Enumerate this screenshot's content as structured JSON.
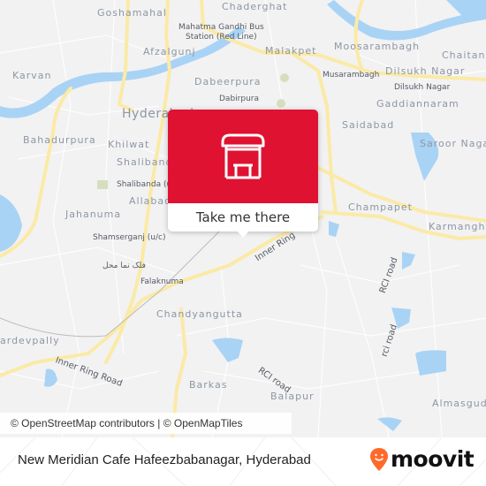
{
  "map": {
    "area_labels": [
      {
        "id": "goshamahal",
        "text": "Goshamahal"
      },
      {
        "id": "chaderghat",
        "text": "Chaderghat"
      },
      {
        "id": "karvan",
        "text": "Karvan"
      },
      {
        "id": "afzalgunj",
        "text": "Afzalgunj"
      },
      {
        "id": "malakpet",
        "text": "Malakpet"
      },
      {
        "id": "moosarambagh",
        "text": "Moosarambagh"
      },
      {
        "id": "chaitanya",
        "text": "Chaitanya"
      },
      {
        "id": "dilsukh-nagar-area",
        "text": "Dilsukh Nagar"
      },
      {
        "id": "dabeerpura",
        "text": "Dabeerpura"
      },
      {
        "id": "hyderabad",
        "text": "Hyderabad"
      },
      {
        "id": "gaddiannaram",
        "text": "Gaddiannaram"
      },
      {
        "id": "bahadurpura",
        "text": "Bahadurpura"
      },
      {
        "id": "khilwat",
        "text": "Khilwat"
      },
      {
        "id": "saidabad",
        "text": "Saidabad"
      },
      {
        "id": "saroor-nagar",
        "text": "Saroor Nagar"
      },
      {
        "id": "shalibanda",
        "text": "Shalibanda"
      },
      {
        "id": "allabad",
        "text": "Allabad"
      },
      {
        "id": "jahanuma",
        "text": "Jahanuma"
      },
      {
        "id": "champapet",
        "text": "Champapet"
      },
      {
        "id": "karmanghat",
        "text": "Karmanghat"
      },
      {
        "id": "chandyangutta",
        "text": "Chandyangutta"
      },
      {
        "id": "kishan-bagh-dev-pally",
        "text": "ardevpally"
      },
      {
        "id": "barkas",
        "text": "Barkas"
      },
      {
        "id": "balapur",
        "text": "Balapur"
      },
      {
        "id": "almasguda",
        "text": "Almasguda"
      }
    ],
    "poi_labels": [
      {
        "id": "mgbs",
        "text": "Mahatma Gandhi Bus"
      },
      {
        "id": "mgbs2",
        "text": "Station (Red Line)"
      },
      {
        "id": "musarambagh",
        "text": "Musarambagh"
      },
      {
        "id": "dilsukh-nagar-station",
        "text": "Dilsukh Nagar"
      },
      {
        "id": "dabirpura",
        "text": "Dabirpura"
      },
      {
        "id": "shalibanda-uc",
        "text": "Shalibanda (u/c)"
      },
      {
        "id": "shamserganj",
        "text": "Shamserganj (u/c)"
      },
      {
        "id": "falaknuma-urdu",
        "text": "فلک نما محل"
      },
      {
        "id": "falaknuma",
        "text": "Falaknuma"
      }
    ],
    "road_labels": [
      {
        "id": "inner-ring-1",
        "text": "Inner Ring"
      },
      {
        "id": "inner-ring-road",
        "text": "Inner Ring Road"
      },
      {
        "id": "rci-road-1",
        "text": "RCI road"
      },
      {
        "id": "rci-road-2",
        "text": "rci road"
      },
      {
        "id": "rci-road-3",
        "text": "RCI road"
      }
    ],
    "popup": {
      "icon": "bus-stop-shelter-icon",
      "cta_label": "Take me there",
      "accent": "#e01232"
    },
    "attribution": "© OpenStreetMap contributors | © OpenMapTiles",
    "colors": {
      "land": "#f2f2f3",
      "water": "#a9d3f5",
      "major_road": "#fbeaa6",
      "park": "#d5dfbd"
    }
  },
  "footer": {
    "title": "New Meridian Cafe Hafeezbabanagar, Hyderabad",
    "brand": "moovit",
    "brand_color": "#ff6a2b"
  }
}
